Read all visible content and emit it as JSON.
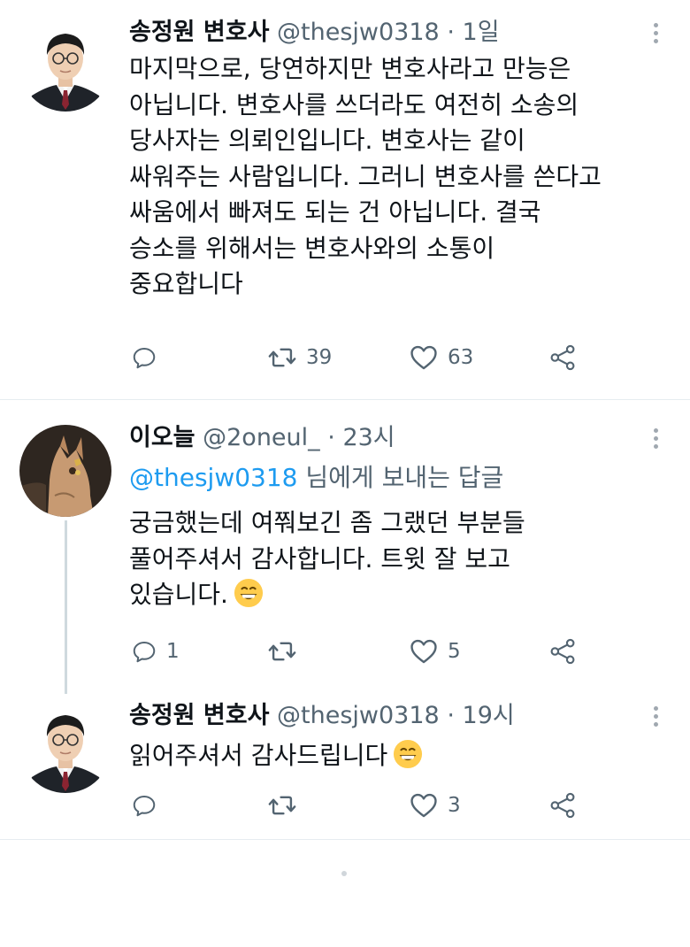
{
  "colors": {
    "accent": "#1d9bf0",
    "text": "#0f1419",
    "muted": "#536471",
    "divider": "#e6ecf0"
  },
  "tweets": [
    {
      "name": "송정원 변호사",
      "handle": "@thesjw0318",
      "separator": "·",
      "time": "1일",
      "lines": [
        "마지막으로, 당연하지만 변호사라고 만능은",
        "아닙니다. 변호사를 쓰더라도 여전히 소송의",
        "당사자는 의뢰인입니다. 변호사는 같이",
        "싸워주는 사람입니다. 그러니 변호사를 쓴다고",
        "싸움에서 빠져도 되는 건 아닙니다. 결국",
        "승소를 위해서는 변호사와의 소통이",
        "중요합니다"
      ],
      "reply_count": "",
      "retweet_count": "39",
      "like_count": "63",
      "avatar_icon": "lawyer-portrait-avatar"
    },
    {
      "name": "이오늘",
      "handle": "@2oneul_",
      "separator": "·",
      "time": "23시",
      "reply_to_mention": "@thesjw0318",
      "reply_to_suffix": " 님에게 보내는 답글",
      "lines": [
        "궁금했는데 여쭤보긴 좀 그랬던 부분들",
        "풀어주셔서 감사합니다. 트윗 잘 보고",
        "있습니다."
      ],
      "reply_count": "1",
      "retweet_count": "",
      "like_count": "5",
      "avatar_icon": "cat-illustration-avatar"
    },
    {
      "name": "송정원 변호사",
      "handle": "@thesjw0318",
      "separator": "·",
      "time": "19시",
      "lines": [
        "읽어주셔서 감사드립니다"
      ],
      "reply_count": "",
      "retweet_count": "",
      "like_count": "3",
      "avatar_icon": "lawyer-portrait-avatar"
    }
  ],
  "icons": {
    "reply": "reply-icon",
    "retweet": "retweet-icon",
    "like": "heart-icon",
    "share": "share-icon",
    "more": "more-options-icon",
    "emoji": "grinning-face-emoji"
  }
}
